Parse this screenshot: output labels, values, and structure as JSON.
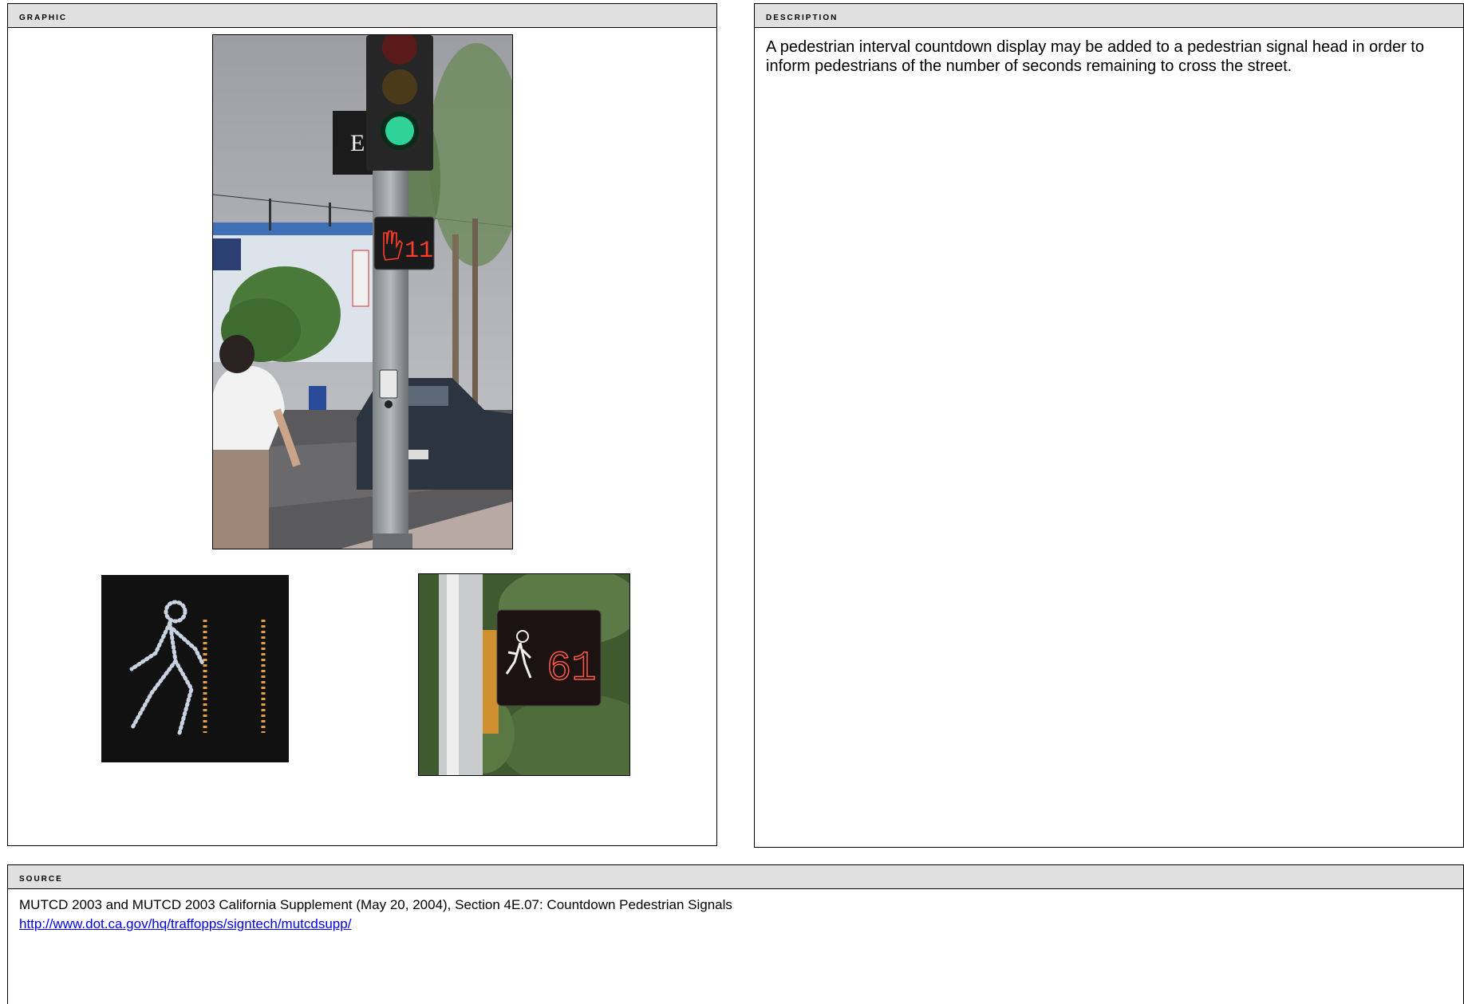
{
  "graphic": {
    "header": "Graphic"
  },
  "description": {
    "header": "Description",
    "text": "A pedestrian interval countdown display may be added to a pedestrian signal head in order to inform pedestrians of the number of seconds remaining to cross the street."
  },
  "source": {
    "header": "Source",
    "citation": "MUTCD 2003 and MUTCD 2003 California Supplement (May 20, 2004), Section 4E.07: Countdown Pedestrian Signals",
    "link": "http://www.dot.ca.gov/hq/traffopps/signtech/mutcdsupp/"
  },
  "photos": {
    "main_countdown_digits": "11",
    "small_countdown_digits": "61"
  },
  "colors": {
    "header_bg": "#e0e0e0",
    "link": "#0000ee",
    "signal_green": "#2fd39a",
    "signal_red": "#ff3b2a",
    "led_amber": "#e0a040"
  }
}
